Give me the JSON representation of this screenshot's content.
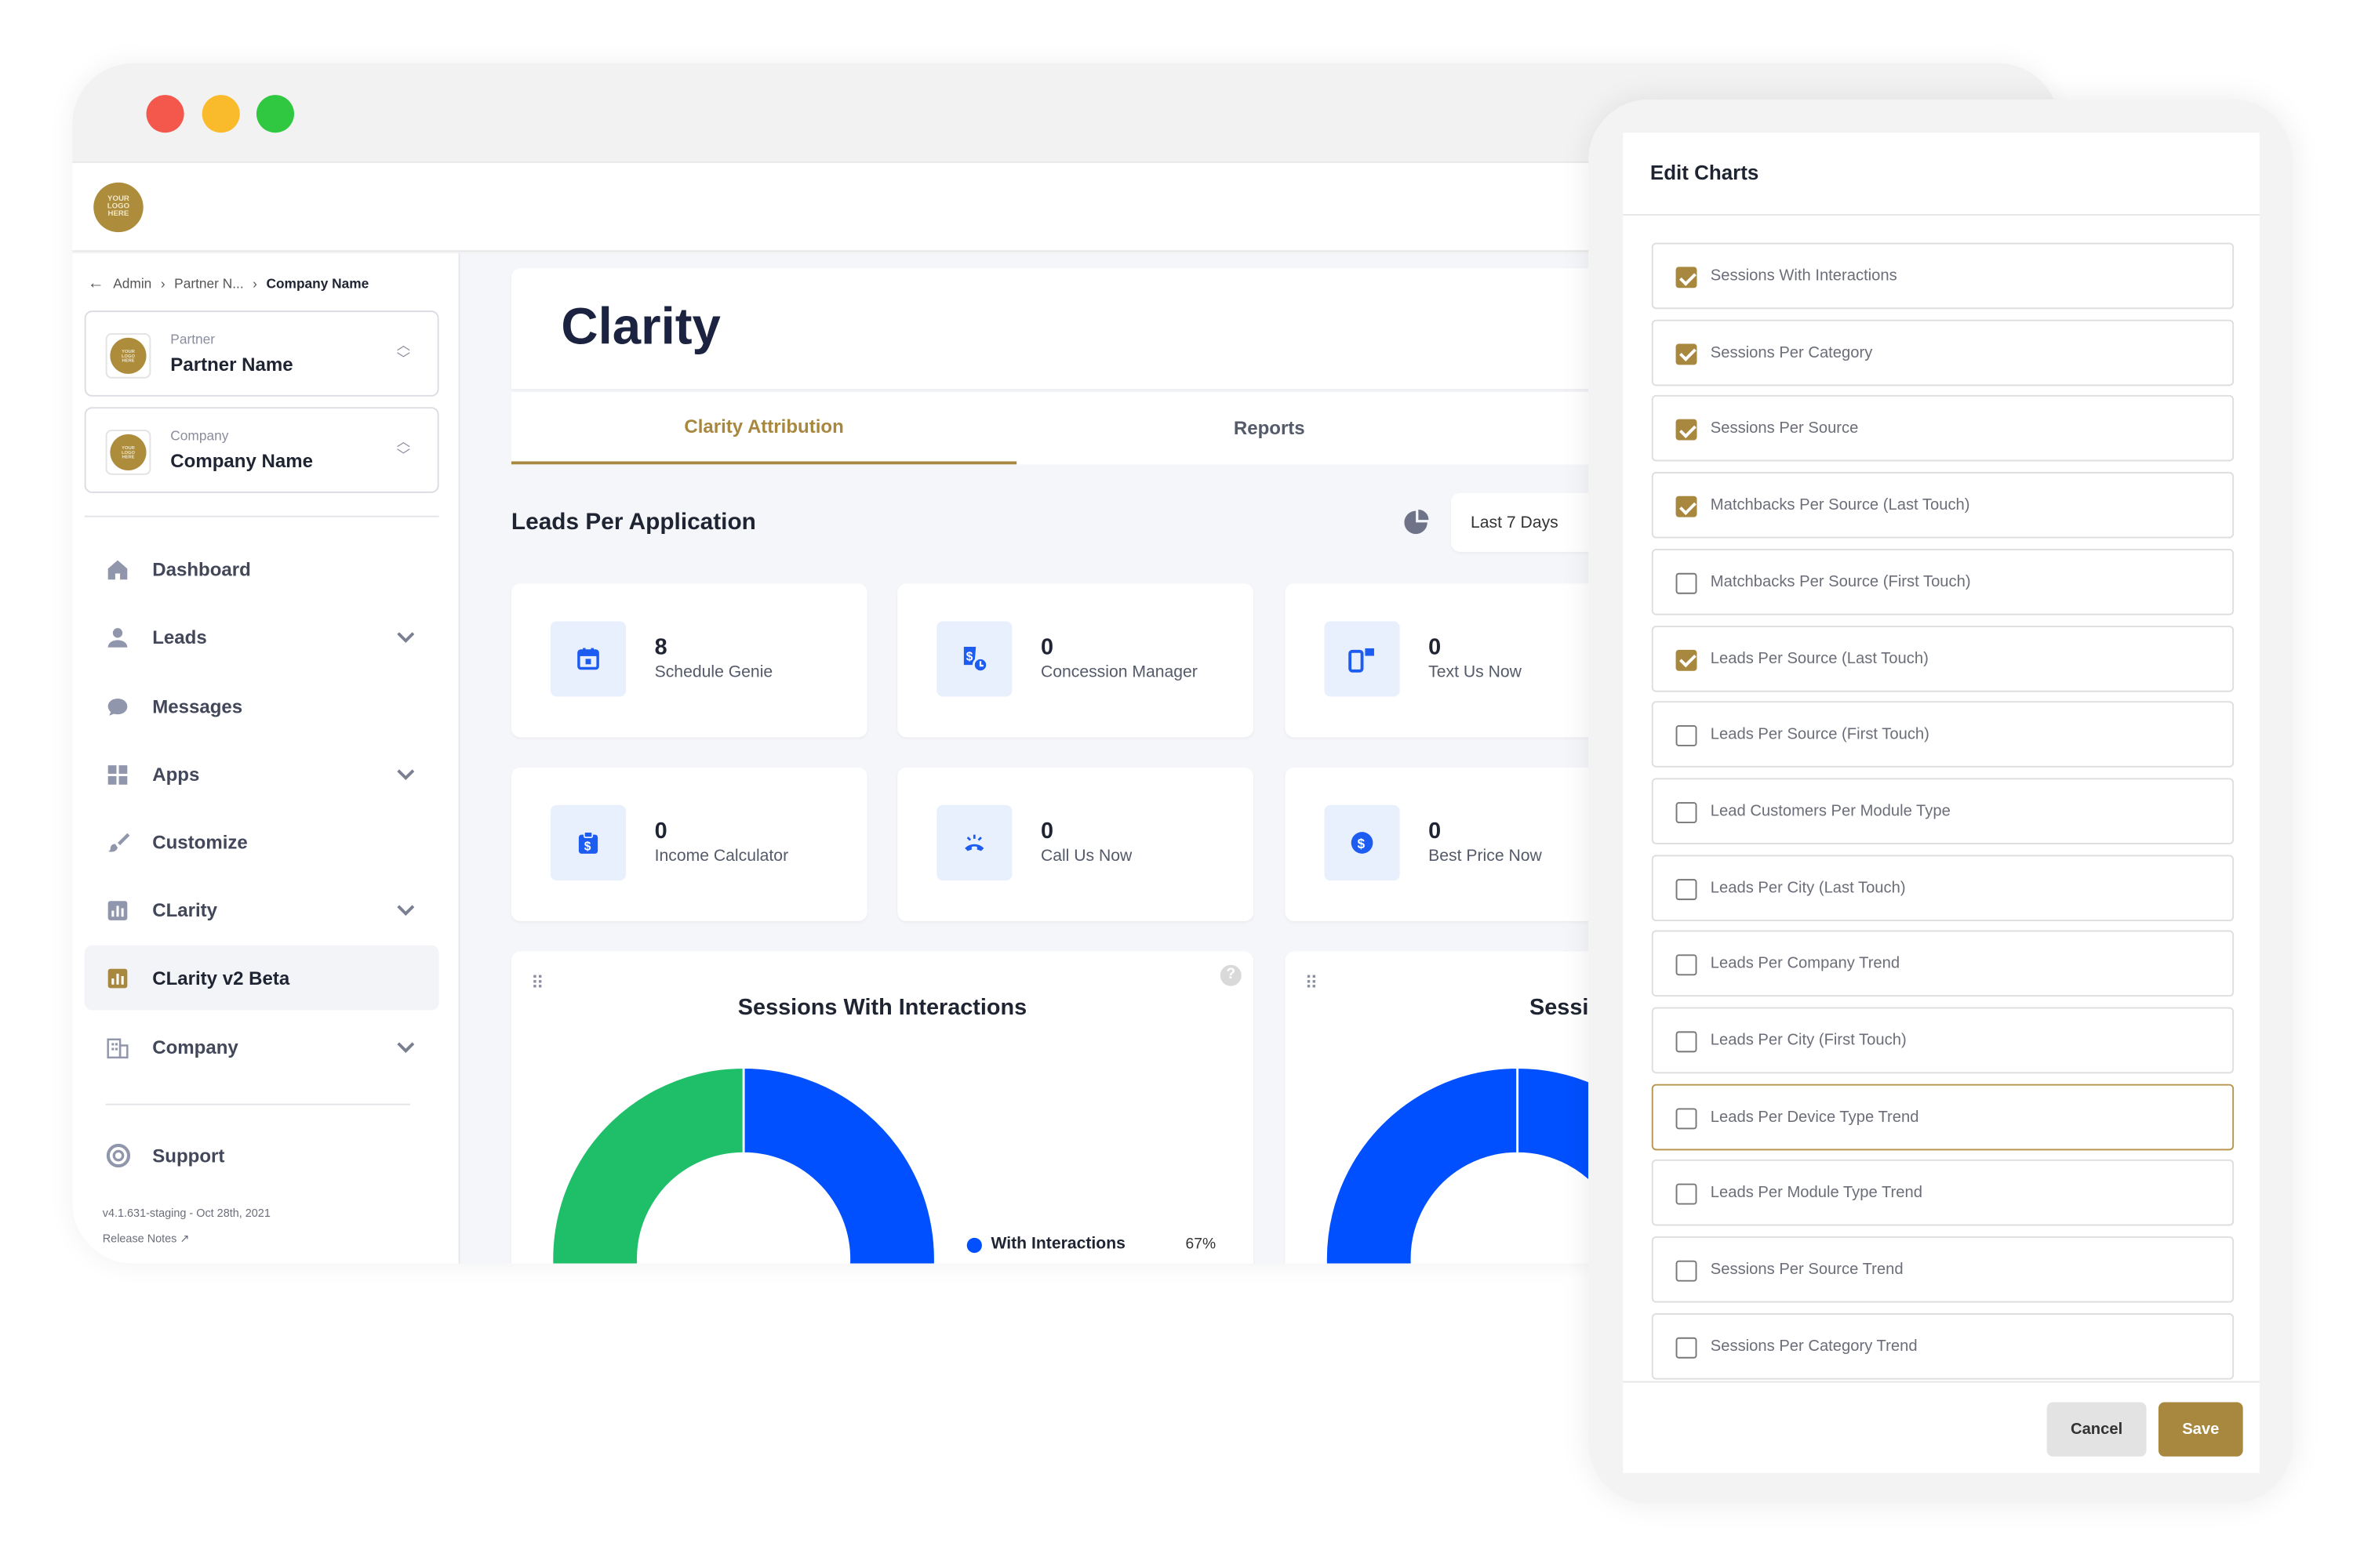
{
  "colors": {
    "accent": "#a8873f",
    "primary_blue": "#0050ff",
    "green": "#1fbf6a",
    "traffic": [
      "#f4574c",
      "#f9bb2c",
      "#2fc840"
    ]
  },
  "logo_text": "YOUR LOGO HERE",
  "breadcrumb": {
    "items": [
      "Admin",
      "Partner N...",
      "Company Name"
    ]
  },
  "partner": {
    "label": "Partner",
    "name": "Partner Name"
  },
  "company": {
    "label": "Company",
    "name": "Company Name"
  },
  "sidebar": {
    "items": [
      {
        "label": "Dashboard",
        "icon": "home-icon",
        "chevron": false
      },
      {
        "label": "Leads",
        "icon": "user-icon",
        "chevron": true
      },
      {
        "label": "Messages",
        "icon": "chat-icon",
        "chevron": false
      },
      {
        "label": "Apps",
        "icon": "grid-icon",
        "chevron": true
      },
      {
        "label": "Customize",
        "icon": "brush-icon",
        "chevron": false
      },
      {
        "label": "CLarity",
        "icon": "chart-icon",
        "chevron": true
      },
      {
        "label": "CLarity v2 Beta",
        "icon": "chart-icon",
        "chevron": false,
        "active": true
      },
      {
        "label": "Company",
        "icon": "building-icon",
        "chevron": true
      }
    ],
    "support": "Support",
    "version": "v4.1.631-staging - Oct 28th, 2021",
    "release_notes": "Release Notes"
  },
  "page": {
    "title": "Clarity",
    "tabs": [
      {
        "label": "Clarity Attribution",
        "active": true
      },
      {
        "label": "Reports",
        "active": false
      }
    ],
    "section_title": "Leads Per Application",
    "date_range": "Last 7 Days"
  },
  "stats": [
    {
      "value": "8",
      "label": "Schedule Genie",
      "icon": "calendar-icon"
    },
    {
      "value": "0",
      "label": "Concession Manager",
      "icon": "price-tag-clock-icon"
    },
    {
      "value": "0",
      "label": "Text Us Now",
      "icon": "mobile-message-icon"
    },
    {
      "value": "0",
      "label": "Income Calculator",
      "icon": "clipboard-dollar-icon"
    },
    {
      "value": "0",
      "label": "Call Us Now",
      "icon": "phone-ring-icon"
    },
    {
      "value": "0",
      "label": "Best Price Now",
      "icon": "dollar-circle-icon"
    }
  ],
  "chart_data": [
    {
      "type": "pie",
      "donut": true,
      "title": "Sessions With Interactions",
      "series": [
        {
          "name": "With Interactions",
          "value": 67,
          "color": "#0050ff"
        },
        {
          "value": 33,
          "color": "#1fbf6a"
        }
      ],
      "legend": [
        {
          "label": "With Interactions",
          "value": "67%"
        }
      ]
    },
    {
      "type": "pie",
      "donut": true,
      "title": "Sessi",
      "series": [
        {
          "value": 100,
          "color": "#0050ff"
        }
      ]
    }
  ],
  "edit_charts": {
    "title": "Edit Charts",
    "cancel": "Cancel",
    "save": "Save",
    "items": [
      {
        "label": "Sessions With Interactions",
        "checked": true
      },
      {
        "label": "Sessions Per Category",
        "checked": true
      },
      {
        "label": "Sessions Per Source",
        "checked": true
      },
      {
        "label": "Matchbacks Per Source (Last Touch)",
        "checked": true
      },
      {
        "label": "Matchbacks Per Source (First Touch)",
        "checked": false
      },
      {
        "label": "Leads Per Source (Last Touch)",
        "checked": true
      },
      {
        "label": "Leads Per Source (First Touch)",
        "checked": false
      },
      {
        "label": "Lead Customers Per Module Type",
        "checked": false
      },
      {
        "label": "Leads Per City (Last Touch)",
        "checked": false
      },
      {
        "label": "Leads Per Company Trend",
        "checked": false
      },
      {
        "label": "Leads Per City (First Touch)",
        "checked": false
      },
      {
        "label": "Leads Per Device Type Trend",
        "checked": false,
        "focused": true
      },
      {
        "label": "Leads Per Module Type Trend",
        "checked": false
      },
      {
        "label": "Sessions Per Source Trend",
        "checked": false
      },
      {
        "label": "Sessions Per Category Trend",
        "checked": false
      }
    ]
  }
}
